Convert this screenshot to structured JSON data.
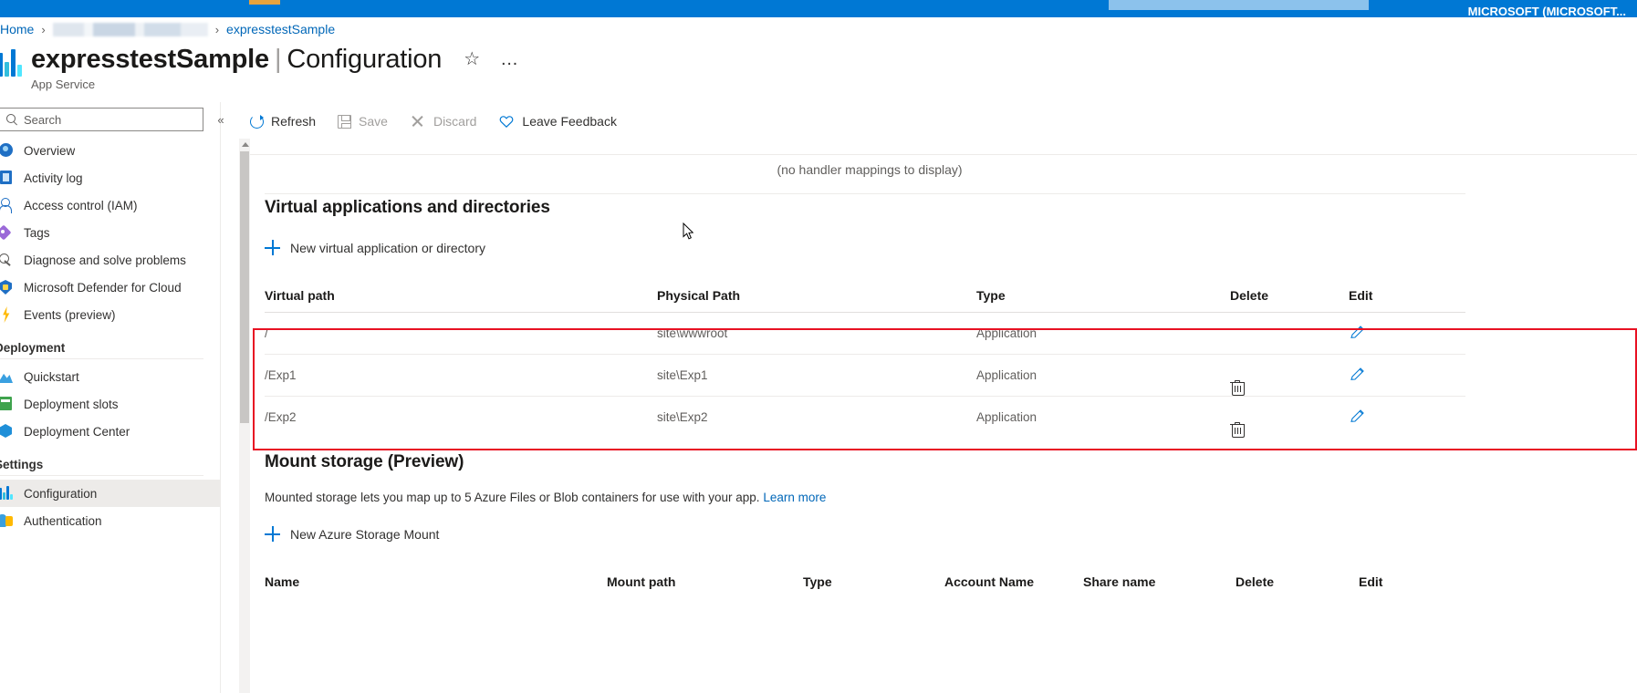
{
  "topbar": {
    "tenant": "MICROSOFT (MICROSOFT..."
  },
  "breadcrumb": {
    "home": "Home",
    "sep": "›",
    "redacted": "",
    "current": "expresstestSample"
  },
  "header": {
    "resource_name": "expresstestSample",
    "separator": "|",
    "page": "Configuration",
    "subtitle": "App Service",
    "favorite_icon": "☆",
    "more_icon": "…"
  },
  "sidebar": {
    "search_placeholder": "Search",
    "search_value": "",
    "collapse_icon": "«",
    "items": [
      {
        "label": "Overview",
        "icon": "overview-icon",
        "glyph": "gl-overview",
        "selected": false
      },
      {
        "label": "Activity log",
        "icon": "activity-log-icon",
        "glyph": "gl-activity",
        "selected": false
      },
      {
        "label": "Access control (IAM)",
        "icon": "access-control-icon",
        "glyph": "gl-iam",
        "selected": false
      },
      {
        "label": "Tags",
        "icon": "tag-icon",
        "glyph": "gl-tags",
        "selected": false
      },
      {
        "label": "Diagnose and solve problems",
        "icon": "wrench-icon",
        "glyph": "gl-diag",
        "selected": false
      },
      {
        "label": "Microsoft Defender for Cloud",
        "icon": "shield-icon",
        "glyph": "gl-defender",
        "selected": false
      },
      {
        "label": "Events (preview)",
        "icon": "lightning-icon",
        "glyph": "gl-events",
        "selected": false
      }
    ],
    "groups": [
      {
        "title": "Deployment",
        "items": [
          {
            "label": "Quickstart",
            "icon": "rocket-icon",
            "glyph": "gl-quick",
            "selected": false
          },
          {
            "label": "Deployment slots",
            "icon": "deployment-slots-icon",
            "glyph": "gl-slots",
            "selected": false
          },
          {
            "label": "Deployment Center",
            "icon": "deployment-center-icon",
            "glyph": "gl-depcenter",
            "selected": false
          }
        ]
      },
      {
        "title": "Settings",
        "items": [
          {
            "label": "Configuration",
            "icon": "configuration-icon",
            "glyph": "gl-config",
            "selected": true
          },
          {
            "label": "Authentication",
            "icon": "authentication-icon",
            "glyph": "gl-auth",
            "selected": false
          }
        ]
      }
    ]
  },
  "toolbar": {
    "refresh": "Refresh",
    "save": "Save",
    "discard": "Discard",
    "feedback": "Leave Feedback",
    "save_disabled": true,
    "discard_disabled": true
  },
  "main": {
    "no_handler_mappings": "(no handler mappings to display)",
    "virtual_apps": {
      "heading": "Virtual applications and directories",
      "add_label": "New virtual application or directory",
      "columns": [
        "Virtual path",
        "Physical Path",
        "Type",
        "Delete",
        "Edit"
      ],
      "rows": [
        {
          "virtual_path": "/",
          "physical_path": "site\\wwwroot",
          "type": "Application",
          "deletable": false,
          "editable": true
        },
        {
          "virtual_path": "/Exp1",
          "physical_path": "site\\Exp1",
          "type": "Application",
          "deletable": true,
          "editable": true
        },
        {
          "virtual_path": "/Exp2",
          "physical_path": "site\\Exp2",
          "type": "Application",
          "deletable": true,
          "editable": true
        }
      ]
    },
    "mount_storage": {
      "heading": "Mount storage (Preview)",
      "description": "Mounted storage lets you map up to 5 Azure Files or Blob containers for use with your app.",
      "learn_more": "Learn more",
      "add_label": "New Azure Storage Mount",
      "columns": [
        "Name",
        "Mount path",
        "Type",
        "Account Name",
        "Share name",
        "Delete",
        "Edit"
      ]
    }
  },
  "colors": {
    "accent": "#0078d4",
    "link": "#0067b8",
    "highlight_box": "#e81123",
    "selected_nav": "#edebe9"
  }
}
